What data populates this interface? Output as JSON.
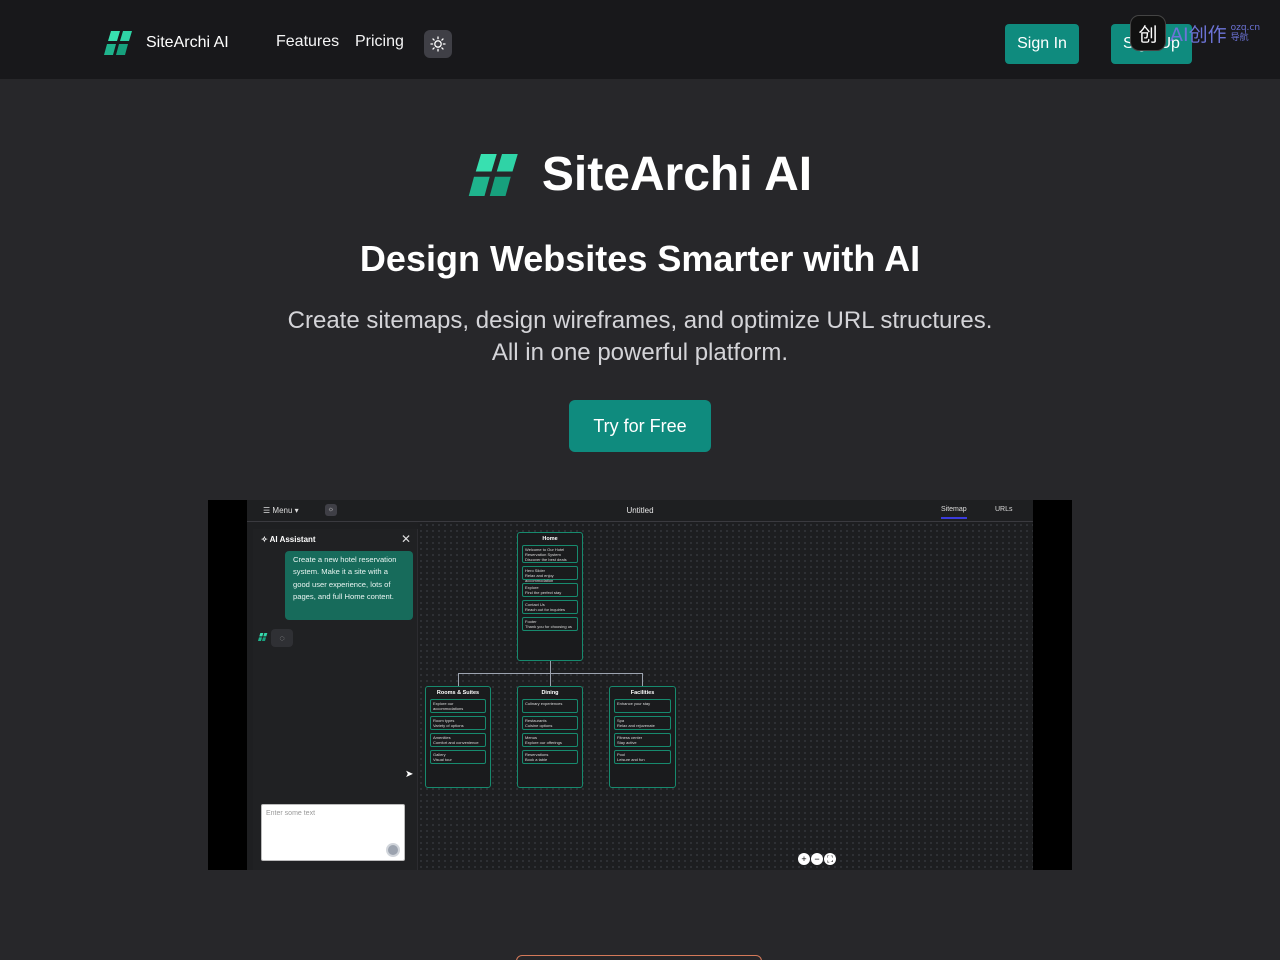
{
  "nav": {
    "brand": "SiteArchi AI",
    "links": [
      "Features",
      "Pricing"
    ],
    "sign_in": "Sign In",
    "sign_up": "Sign Up"
  },
  "overlay_badge": {
    "icon_text": "创",
    "text": "AI创作",
    "small_top": "ozq.cn",
    "small_bottom": "导航"
  },
  "hero": {
    "title": "SiteArchi AI",
    "subtitle": "Design Websites Smarter with AI",
    "desc_line1": "Create sitemaps, design wireframes, and optimize URL structures.",
    "desc_line2": "All in one powerful platform.",
    "cta": "Try for Free"
  },
  "demo": {
    "menu_label": "Menu",
    "doc_title": "Untitled",
    "tabs": [
      "Sitemap",
      "URLs"
    ],
    "panel_title": "AI Assistant",
    "user_message": "Create a new hotel reservation system. Make it a site with a good user experience, lots of pages, and full Home content.",
    "input_placeholder": "Enter some text",
    "nodes": {
      "home": {
        "title": "Home",
        "sections": [
          {
            "name": "Welcome to Our Hotel Reservation System",
            "desc": "Discover the best deals"
          },
          {
            "name": "Hero Slider",
            "desc": "Relax and enjoy accommodation"
          },
          {
            "name": "Explore",
            "desc": "Find the perfect stay"
          },
          {
            "name": "Contact Us",
            "desc": "Reach out for inquiries"
          },
          {
            "name": "Footer",
            "desc": "Thank you for choosing us"
          }
        ]
      },
      "rooms": {
        "title": "Rooms & Suites",
        "sections": [
          {
            "name": "Explore our accommodations",
            "desc": ""
          },
          {
            "name": "Room types",
            "desc": "Variety of options"
          },
          {
            "name": "Amenities",
            "desc": "Comfort and convenience"
          },
          {
            "name": "Gallery",
            "desc": "Visual tour"
          }
        ]
      },
      "dining": {
        "title": "Dining",
        "sections": [
          {
            "name": "Culinary experiences",
            "desc": ""
          },
          {
            "name": "Restaurants",
            "desc": "Cuisine options"
          },
          {
            "name": "Menus",
            "desc": "Explore our offerings"
          },
          {
            "name": "Reservations",
            "desc": "Book a table"
          }
        ]
      },
      "facilities": {
        "title": "Facilities",
        "sections": [
          {
            "name": "Enhance your stay",
            "desc": ""
          },
          {
            "name": "Spa",
            "desc": "Relax and rejuvenate"
          },
          {
            "name": "Fitness center",
            "desc": "Stay active"
          },
          {
            "name": "Pool",
            "desc": "Leisure and fun"
          }
        ]
      }
    },
    "zoom_controls": [
      "+",
      "−",
      "⛶"
    ]
  },
  "colors": {
    "accent": "#0f8b7e",
    "brand_logo": "#2fd3a6",
    "background": "#27272a",
    "nav_bg": "#18181b"
  }
}
